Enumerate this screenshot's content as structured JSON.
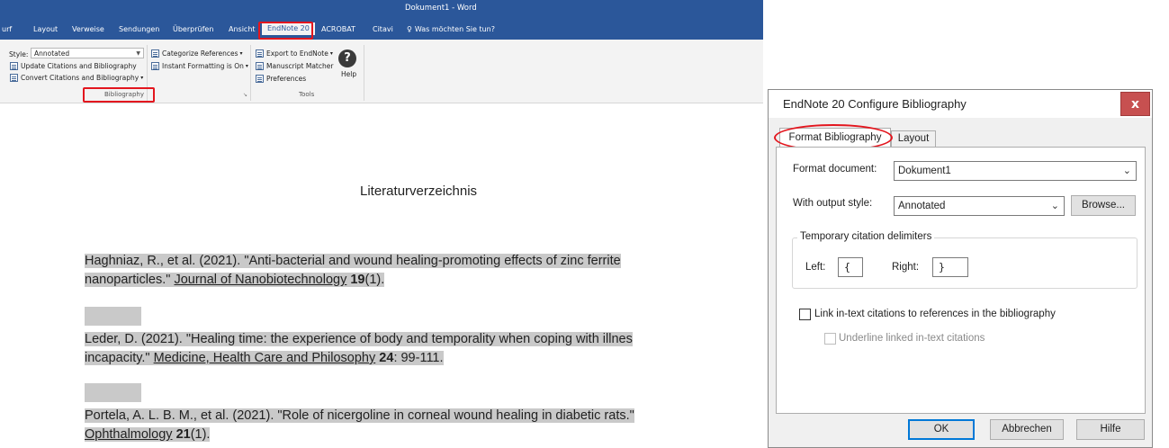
{
  "word": {
    "window_title": "Dokument1 - Word",
    "tabs": [
      {
        "label": "urf"
      },
      {
        "label": "Layout"
      },
      {
        "label": "Verweise"
      },
      {
        "label": "Sendungen"
      },
      {
        "label": "Überprüfen"
      },
      {
        "label": "Ansicht"
      },
      {
        "label": "EndNote 20"
      },
      {
        "label": "ACROBAT"
      },
      {
        "label": "Citavi"
      }
    ],
    "tell_me": "Was möchten Sie tun?",
    "ribbon": {
      "style_label": "Style:",
      "style_value": "Annotated",
      "update_citations": "Update Citations and Bibliography",
      "convert_citations": "Convert Citations and Bibliography",
      "categorize_references": "Categorize References",
      "instant_formatting": "Instant Formatting is On",
      "export_to_endnote": "Export to EndNote",
      "manuscript_matcher": "Manuscript Matcher",
      "preferences": "Preferences",
      "help": "Help",
      "group_bibliography": "Bibliography",
      "group_tools": "Tools"
    },
    "document": {
      "heading": "Literaturverzeichnis",
      "references": [
        {
          "line1": "Haghniaz, R., et al. (2021). \"Anti-bacterial and wound healing-promoting effects of zinc ferrite",
          "line2_pre": "nanoparticles.\" ",
          "journal": "Journal of Nanobiotechnology",
          "volume": "19",
          "rest": "(1)."
        },
        {
          "line1": "Leder, D. (2021). \"Healing time: the experience of body and temporality when coping with illnes",
          "line2_pre": "incapacity.\" ",
          "journal": "Medicine, Health Care and Philosophy",
          "volume": "24",
          "rest": ": 99-111."
        },
        {
          "line1": "Portela, A. L. B. M., et al. (2021). \"Role of nicergoline in corneal wound healing in diabetic rats.\"",
          "line2_pre": "",
          "journal": "Ophthalmology",
          "volume": "21",
          "rest": "(1)."
        }
      ]
    }
  },
  "dialog": {
    "title": "EndNote 20 Configure Bibliography",
    "close": "x",
    "tabs": [
      "Format Bibliography",
      "Layout"
    ],
    "format_document_label": "Format document:",
    "format_document_value": "Dokument1",
    "output_style_label": "With output style:",
    "output_style_value": "Annotated",
    "browse_button": "Browse...",
    "delimiters_group": "Temporary citation delimiters",
    "left_label": "Left:",
    "left_value": "{",
    "right_label": "Right:",
    "right_value": "}",
    "link_checkbox_label": "Link in-text citations to references in the bibliography",
    "underline_checkbox_label": "Underline linked in-text citations",
    "ok_button": "OK",
    "cancel_button": "Abbrechen",
    "help_button": "Hilfe"
  },
  "colors": {
    "word_blue": "#2b579a",
    "highlight_red": "#e3161e",
    "close_red": "#c75050",
    "field_highlight_gray": "#c9c9c9"
  }
}
